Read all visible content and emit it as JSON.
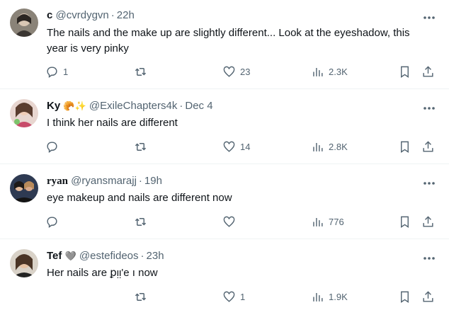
{
  "tweets": [
    {
      "name": "c",
      "handle": "@cvrdygvn",
      "time": "22h",
      "text": "The nails and the make up are slightly different... Look at the eyeshadow, this year is very pinky",
      "replies": "1",
      "retweets": "",
      "likes": "23",
      "views": "2.3K"
    },
    {
      "name": "Ky",
      "name_emoji": "🥐✨",
      "handle": "@ExileChapters4k",
      "time": "Dec 4",
      "text": "I think her nails are different",
      "replies": "",
      "retweets": "",
      "likes": "14",
      "views": "2.8K"
    },
    {
      "name": "ryan",
      "handle": "@ryansmarajj",
      "time": "19h",
      "text": "eye makeup and nails are different now",
      "replies": "",
      "retweets": "",
      "likes": "",
      "views": "776"
    },
    {
      "name": "Tef",
      "name_emoji": "🩶",
      "handle": "@estefideos",
      "time": "23h",
      "text": "Her nails are ꝑᴉᴉ'e ı now",
      "replies": "",
      "retweets": "",
      "likes": "1",
      "views": "1.9K"
    }
  ],
  "icons": {
    "more": "more-icon",
    "reply": "reply-icon",
    "retweet": "retweet-icon",
    "like": "heart-icon",
    "views": "views-icon",
    "bookmark": "bookmark-icon",
    "share": "share-icon"
  },
  "colors": {
    "text": "#0f1419",
    "secondary": "#536471",
    "divider": "#eff3f4"
  }
}
